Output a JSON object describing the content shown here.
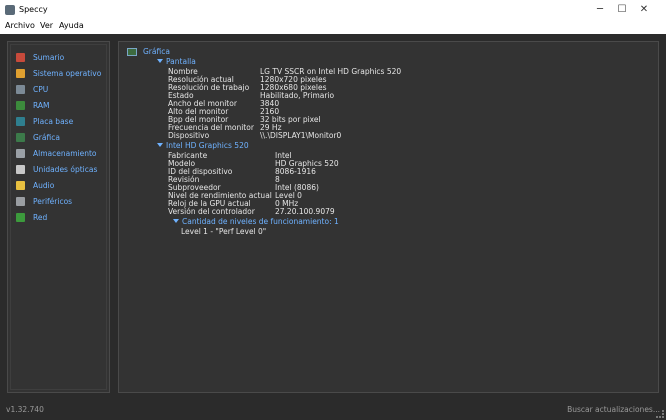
{
  "window": {
    "title": "Speccy",
    "controls": {
      "minimize": "─",
      "maximize": "☐",
      "close": "✕"
    }
  },
  "menu": [
    "Archivo",
    "Ver",
    "Ayuda"
  ],
  "sidebar": {
    "items": [
      {
        "label": "Sumario",
        "icon": "summary-icon",
        "color": "#c74a3b"
      },
      {
        "label": "Sistema operativo",
        "icon": "windows-icon",
        "color": "#e0a030"
      },
      {
        "label": "CPU",
        "icon": "cpu-icon",
        "color": "#7c8a96"
      },
      {
        "label": "RAM",
        "icon": "ram-icon",
        "color": "#3c8b3c"
      },
      {
        "label": "Placa base",
        "icon": "motherboard-icon",
        "color": "#2f7f8f"
      },
      {
        "label": "Gráfica",
        "icon": "graphics-icon",
        "color": "#3c7a4a"
      },
      {
        "label": "Almacenamiento",
        "icon": "storage-icon",
        "color": "#9aa0a6"
      },
      {
        "label": "Unidades ópticas",
        "icon": "optical-drive-icon",
        "color": "#c8c8c8"
      },
      {
        "label": "Audio",
        "icon": "audio-icon",
        "color": "#e8c040"
      },
      {
        "label": "Periféricos",
        "icon": "peripherals-icon",
        "color": "#9a9ea2"
      },
      {
        "label": "Red",
        "icon": "network-icon",
        "color": "#3c9a3c"
      }
    ]
  },
  "content": {
    "section_title": "Gráfica",
    "pantalla": {
      "header": "Pantalla",
      "rows": [
        {
          "k": "Nombre",
          "v": "LG TV SSCR on Intel HD Graphics 520"
        },
        {
          "k": "Resolución actual",
          "v": "1280x720 pixeles"
        },
        {
          "k": "Resolución de trabajo",
          "v": "1280x680 pixeles"
        },
        {
          "k": "Estado",
          "v": "Habilitado, Primario"
        },
        {
          "k": "Ancho del monitor",
          "v": "3840"
        },
        {
          "k": "Alto del monitor",
          "v": "2160"
        },
        {
          "k": "Bpp del monitor",
          "v": "32 bits por pixel"
        },
        {
          "k": "Frecuencia del monitor",
          "v": "29 Hz"
        },
        {
          "k": "Dispositivo",
          "v": "\\\\.\\DISPLAY1\\Monitor0"
        }
      ]
    },
    "gpu": {
      "header": "Intel HD Graphics 520",
      "rows": [
        {
          "k": "Fabricante",
          "v": "Intel"
        },
        {
          "k": "Modelo",
          "v": "HD Graphics 520"
        },
        {
          "k": "ID del dispositivo",
          "v": "8086-1916"
        },
        {
          "k": "Revisión",
          "v": "8"
        },
        {
          "k": "Subproveedor",
          "v": "Intel (8086)"
        },
        {
          "k": "Nivel de rendimiento actual",
          "v": "Level 0"
        },
        {
          "k": "Reloj de la GPU actual",
          "v": "0 MHz"
        },
        {
          "k": "Versión del controlador",
          "v": "27.20.100.9079"
        }
      ],
      "perf_header": "Cantidad de niveles de funcionamiento: 1",
      "perf_level": "Level 1 - \"Perf Level 0\""
    }
  },
  "status": {
    "version": "v1.32.740",
    "update": "Buscar actualizaciones..."
  }
}
